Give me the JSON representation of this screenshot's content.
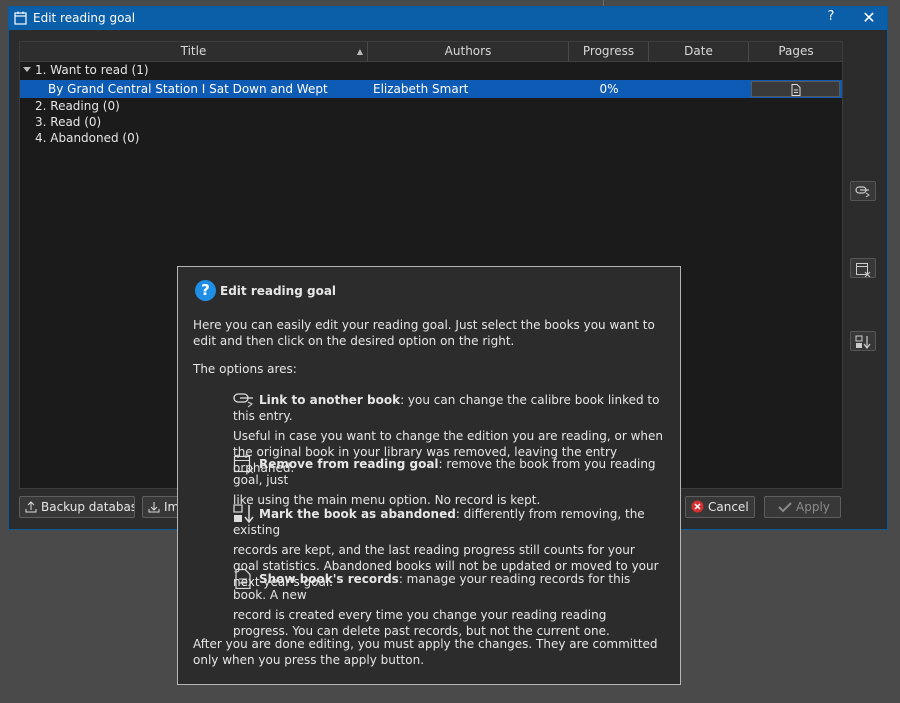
{
  "window": {
    "title": "Edit reading goal",
    "help_label": "?",
    "close_label": "✕"
  },
  "table": {
    "columns": [
      "Title",
      "Authors",
      "Progress",
      "Date",
      "Pages"
    ],
    "groups": [
      {
        "label": "1. Want to read (1)",
        "expanded": true,
        "books": [
          {
            "title": "By Grand Central Station I Sat Down and Wept",
            "author": "Elizabeth Smart",
            "progress": "0%",
            "date": ""
          }
        ]
      },
      {
        "label": "2. Reading (0)"
      },
      {
        "label": "3. Read (0)"
      },
      {
        "label": "4. Abandoned (0)"
      }
    ]
  },
  "side_buttons": [
    "link-icon",
    "calendar-remove-icon",
    "abandon-icon"
  ],
  "buttons": {
    "backup": "Backup database",
    "import": "Im",
    "cancel": "Cancel",
    "apply": "Apply"
  },
  "tooltip": {
    "heading": "Edit reading goal",
    "intro": "Here you can easily edit your reading goal. Just select the books you want to edit and then click on the desired option on the right.",
    "options_label": "The options ares:",
    "options": [
      {
        "name": "Link to another book",
        "rest": ": you can change the calibre book linked to this entry.",
        "detail": "Useful in case you want to change the edition you are reading, or when the original book in your library was removed, leaving the entry orphaned."
      },
      {
        "name": "Remove from reading goal",
        "rest": ": remove the book from you reading goal, just",
        "detail": "like using the main menu option. No record is kept."
      },
      {
        "name": "Mark the book as abandoned",
        "rest": ": differently from removing, the existing",
        "detail": "records are kept, and the last reading progress still counts for your goal statistics. Abandoned books will not be updated or moved to your next year's goal."
      },
      {
        "name": "Show book's records",
        "rest": ": manage your reading records for this book. A new",
        "detail": "record is created every time you change your reading reading progress. You can delete past records, but not the current one."
      }
    ],
    "outro": "After you are done editing, you must apply the changes. They are committed only when you press the apply button."
  },
  "colors": {
    "selection": "#0d5bb5",
    "titlebar": "#0b5ea8",
    "help": "#1f8fe6"
  }
}
